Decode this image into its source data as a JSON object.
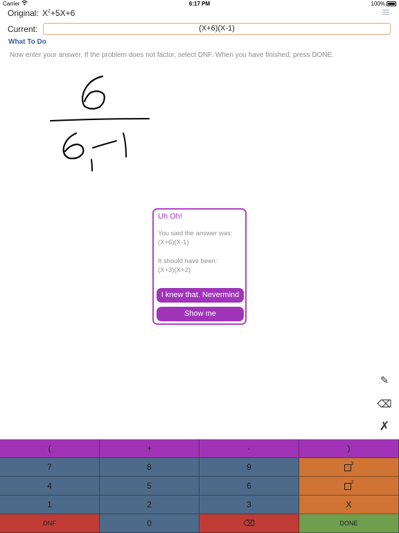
{
  "status_bar": {
    "carrier": "Carrier",
    "time": "6:17 PM",
    "battery": "100%"
  },
  "header": {
    "original_label": "Original:",
    "original_expr_base": "X",
    "original_expr_exp": "2",
    "original_expr_rest": "+5X+6",
    "current_label": "Current:",
    "current_value": "(X+6)(X-1)",
    "what_to_do": "What To Do",
    "instructions": "Now enter your answer.  If the problem does not factor, select DNF.  When you have finished, press DONE.",
    "menu_icon": "hamburger-menu-icon"
  },
  "dialog": {
    "title": "Uh Oh!",
    "said_label": "You said the answer was:",
    "said_value": "(X+6)(X-1)",
    "should_label": "It should have been:",
    "should_value": "(X+3)(X+2)",
    "nevermind_button": "I knew that.  Nevermind",
    "show_me_button": "Show me"
  },
  "tools": {
    "pencil": "✎",
    "backspace": "⌫",
    "clear": "✗"
  },
  "keypad": {
    "row1": [
      "(",
      "+",
      "-",
      ")"
    ],
    "row2": [
      "7",
      "8",
      "9"
    ],
    "row3": [
      "4",
      "5",
      "6"
    ],
    "row4": [
      "1",
      "2",
      "3",
      "X"
    ],
    "row5": [
      "DNF",
      "0",
      "⌫",
      "DONE"
    ],
    "cube_exp": "3",
    "square_exp": "2"
  },
  "colors": {
    "purple": "#a033b5",
    "blue": "#4d6a8a",
    "orange": "#cf7434",
    "red": "#c03c35",
    "green": "#6f9e4f",
    "accent_border": "#e8a27a"
  }
}
